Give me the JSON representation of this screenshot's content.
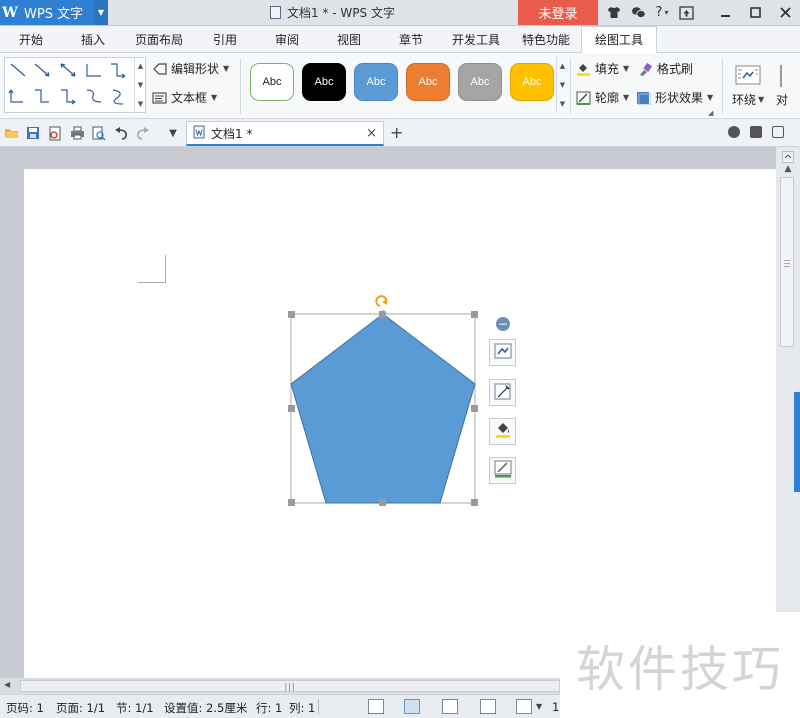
{
  "titlebar": {
    "app_name": "WPS 文字",
    "doc_title": "文档1 * - WPS 文字",
    "login_label": "未登录",
    "icons": [
      "shirt-icon",
      "settings-icon",
      "help-icon",
      "upload-icon"
    ],
    "help_label": "?",
    "window_controls": [
      "minimize",
      "maximize",
      "close"
    ]
  },
  "menu": {
    "tabs": [
      "开始",
      "插入",
      "页面布局",
      "引用",
      "审阅",
      "视图",
      "章节",
      "开发工具",
      "特色功能",
      "绘图工具"
    ],
    "active_tab": "绘图工具"
  },
  "ribbon": {
    "edit_shape_label": "编辑形状",
    "textbox_label": "文本框",
    "style_swatches": [
      {
        "label": "Abc",
        "bg": "#ffffff",
        "fg": "#222222",
        "border": "#7bb36b"
      },
      {
        "label": "Abc",
        "bg": "#000000",
        "fg": "#ffffff",
        "border": "#000000"
      },
      {
        "label": "Abc",
        "bg": "#5b9bd5",
        "fg": "#ffffff",
        "border": "#4a86bd"
      },
      {
        "label": "Abc",
        "bg": "#ed7d31",
        "fg": "#ffffff",
        "border": "#d46c25"
      },
      {
        "label": "Abc",
        "bg": "#a5a5a5",
        "fg": "#ffffff",
        "border": "#8e8e8e"
      },
      {
        "label": "Abc",
        "bg": "#ffc000",
        "fg": "#ffffff",
        "border": "#e0a800"
      }
    ],
    "fill_label": "填充",
    "format_painter_label": "格式刷",
    "outline_label": "轮廓",
    "shape_effects_label": "形状效果",
    "wrap_label": "环绕",
    "align_label": "对"
  },
  "quickbar": {
    "doc_tab_label": "文档1 *",
    "close_label": "×",
    "add_label": "+"
  },
  "document": {
    "shape_fill": "#5b9bd5",
    "shape_stroke": "#41719c",
    "handle_color": "#9a9a9a",
    "rotate_color": "#f0a01c"
  },
  "statusbar": {
    "page_code": "页码: 1",
    "page": "页面: 1/1",
    "section": "节: 1/1",
    "setting": "设置值: 2.5厘米",
    "row": "行: 1",
    "col": "列: 1",
    "right_value": "1"
  },
  "watermark": {
    "text": "软件技巧"
  }
}
